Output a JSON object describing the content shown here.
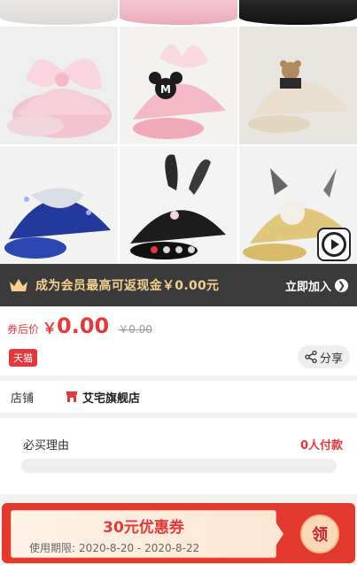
{
  "gallery": {
    "video_icon": "play-circle-icon",
    "carousel_active_index": 0,
    "carousel_count": 4
  },
  "member_bar": {
    "crown_icon": "crown-icon",
    "text": "成为会员最高可返现金￥0.00元",
    "join_label": "立即加入",
    "join_icon": "chevron-right-circle-icon"
  },
  "price": {
    "label": "券后价",
    "symbol": "￥",
    "value": "0.00",
    "original": "￥0.00",
    "badge": "天猫",
    "share_label": "分享",
    "share_icon": "share-icon"
  },
  "shop": {
    "label": "店铺",
    "icon": "store-icon",
    "name": "艾宅旗舰店"
  },
  "must_buy": {
    "title": "必买理由",
    "count": "0人付款"
  },
  "coupon": {
    "amount": "30元优惠券",
    "period_label": "使用期限:",
    "period": "2020-8-20 - 2020-8-22",
    "claim_label": "领"
  },
  "colors": {
    "accent": "#e4393c",
    "member_bar": "#3b3b3b",
    "member_text": "#f6cf8e",
    "coupon_bg": "#e23a2f"
  }
}
